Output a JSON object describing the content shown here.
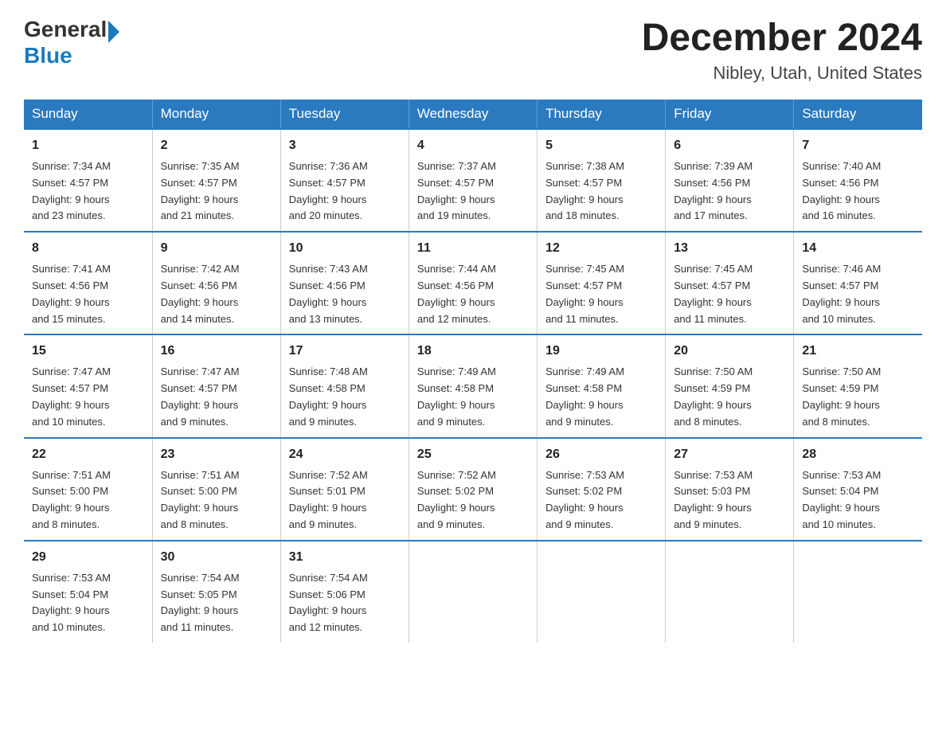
{
  "header": {
    "logo_general": "General",
    "logo_blue": "Blue",
    "title": "December 2024",
    "subtitle": "Nibley, Utah, United States"
  },
  "weekdays": [
    "Sunday",
    "Monday",
    "Tuesday",
    "Wednesday",
    "Thursday",
    "Friday",
    "Saturday"
  ],
  "weeks": [
    [
      {
        "day": "1",
        "sunrise": "7:34 AM",
        "sunset": "4:57 PM",
        "daylight": "9 hours and 23 minutes."
      },
      {
        "day": "2",
        "sunrise": "7:35 AM",
        "sunset": "4:57 PM",
        "daylight": "9 hours and 21 minutes."
      },
      {
        "day": "3",
        "sunrise": "7:36 AM",
        "sunset": "4:57 PM",
        "daylight": "9 hours and 20 minutes."
      },
      {
        "day": "4",
        "sunrise": "7:37 AM",
        "sunset": "4:57 PM",
        "daylight": "9 hours and 19 minutes."
      },
      {
        "day": "5",
        "sunrise": "7:38 AM",
        "sunset": "4:57 PM",
        "daylight": "9 hours and 18 minutes."
      },
      {
        "day": "6",
        "sunrise": "7:39 AM",
        "sunset": "4:56 PM",
        "daylight": "9 hours and 17 minutes."
      },
      {
        "day": "7",
        "sunrise": "7:40 AM",
        "sunset": "4:56 PM",
        "daylight": "9 hours and 16 minutes."
      }
    ],
    [
      {
        "day": "8",
        "sunrise": "7:41 AM",
        "sunset": "4:56 PM",
        "daylight": "9 hours and 15 minutes."
      },
      {
        "day": "9",
        "sunrise": "7:42 AM",
        "sunset": "4:56 PM",
        "daylight": "9 hours and 14 minutes."
      },
      {
        "day": "10",
        "sunrise": "7:43 AM",
        "sunset": "4:56 PM",
        "daylight": "9 hours and 13 minutes."
      },
      {
        "day": "11",
        "sunrise": "7:44 AM",
        "sunset": "4:56 PM",
        "daylight": "9 hours and 12 minutes."
      },
      {
        "day": "12",
        "sunrise": "7:45 AM",
        "sunset": "4:57 PM",
        "daylight": "9 hours and 11 minutes."
      },
      {
        "day": "13",
        "sunrise": "7:45 AM",
        "sunset": "4:57 PM",
        "daylight": "9 hours and 11 minutes."
      },
      {
        "day": "14",
        "sunrise": "7:46 AM",
        "sunset": "4:57 PM",
        "daylight": "9 hours and 10 minutes."
      }
    ],
    [
      {
        "day": "15",
        "sunrise": "7:47 AM",
        "sunset": "4:57 PM",
        "daylight": "9 hours and 10 minutes."
      },
      {
        "day": "16",
        "sunrise": "7:47 AM",
        "sunset": "4:57 PM",
        "daylight": "9 hours and 9 minutes."
      },
      {
        "day": "17",
        "sunrise": "7:48 AM",
        "sunset": "4:58 PM",
        "daylight": "9 hours and 9 minutes."
      },
      {
        "day": "18",
        "sunrise": "7:49 AM",
        "sunset": "4:58 PM",
        "daylight": "9 hours and 9 minutes."
      },
      {
        "day": "19",
        "sunrise": "7:49 AM",
        "sunset": "4:58 PM",
        "daylight": "9 hours and 9 minutes."
      },
      {
        "day": "20",
        "sunrise": "7:50 AM",
        "sunset": "4:59 PM",
        "daylight": "9 hours and 8 minutes."
      },
      {
        "day": "21",
        "sunrise": "7:50 AM",
        "sunset": "4:59 PM",
        "daylight": "9 hours and 8 minutes."
      }
    ],
    [
      {
        "day": "22",
        "sunrise": "7:51 AM",
        "sunset": "5:00 PM",
        "daylight": "9 hours and 8 minutes."
      },
      {
        "day": "23",
        "sunrise": "7:51 AM",
        "sunset": "5:00 PM",
        "daylight": "9 hours and 8 minutes."
      },
      {
        "day": "24",
        "sunrise": "7:52 AM",
        "sunset": "5:01 PM",
        "daylight": "9 hours and 9 minutes."
      },
      {
        "day": "25",
        "sunrise": "7:52 AM",
        "sunset": "5:02 PM",
        "daylight": "9 hours and 9 minutes."
      },
      {
        "day": "26",
        "sunrise": "7:53 AM",
        "sunset": "5:02 PM",
        "daylight": "9 hours and 9 minutes."
      },
      {
        "day": "27",
        "sunrise": "7:53 AM",
        "sunset": "5:03 PM",
        "daylight": "9 hours and 9 minutes."
      },
      {
        "day": "28",
        "sunrise": "7:53 AM",
        "sunset": "5:04 PM",
        "daylight": "9 hours and 10 minutes."
      }
    ],
    [
      {
        "day": "29",
        "sunrise": "7:53 AM",
        "sunset": "5:04 PM",
        "daylight": "9 hours and 10 minutes."
      },
      {
        "day": "30",
        "sunrise": "7:54 AM",
        "sunset": "5:05 PM",
        "daylight": "9 hours and 11 minutes."
      },
      {
        "day": "31",
        "sunrise": "7:54 AM",
        "sunset": "5:06 PM",
        "daylight": "9 hours and 12 minutes."
      },
      null,
      null,
      null,
      null
    ]
  ],
  "labels": {
    "sunrise": "Sunrise:",
    "sunset": "Sunset:",
    "daylight": "Daylight:"
  }
}
